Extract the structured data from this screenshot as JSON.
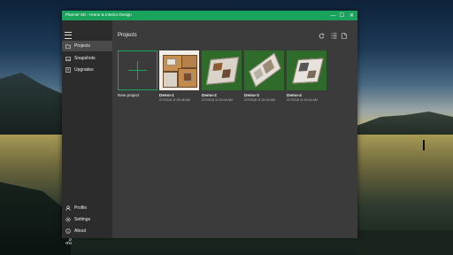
{
  "window": {
    "title": "Planner 5D - Home & Interior Design",
    "controls": {
      "minimize": "—",
      "maximize": "☐",
      "close": "✕"
    },
    "title_bar_color": "#1aa35d"
  },
  "sidebar": {
    "menu_icon": "hamburger-icon",
    "items": [
      {
        "label": "Projects",
        "icon": "folder-icon",
        "active": true
      },
      {
        "label": "Snapshots",
        "icon": "photo-icon"
      },
      {
        "label": "Upgrades",
        "icon": "upgrade-icon"
      }
    ],
    "bottom_items": [
      {
        "label": "Profile",
        "icon": "person-icon"
      },
      {
        "label": "Settings",
        "icon": "gear-icon"
      },
      {
        "label": "About",
        "icon": "info-icon"
      }
    ],
    "bottom_icon": "share-icon"
  },
  "main": {
    "title": "Projects",
    "toolbar": {
      "refresh_icon": "refresh-icon",
      "list_icon": "list-icon",
      "new_icon": "document-icon"
    },
    "new_project_label": "New project",
    "projects": [
      {
        "name": "Demo-1",
        "date": "2/7/2018 11:00:46 AM",
        "thumb": "top-down-plan"
      },
      {
        "name": "Demo-2",
        "date": "2/7/2018 11:00:44 AM",
        "thumb": "iso-green"
      },
      {
        "name": "Demo-3",
        "date": "2/7/2018 11:00:44 AM",
        "thumb": "iso-green"
      },
      {
        "name": "Demo-4",
        "date": "2/7/2018 11:00:44 AM",
        "thumb": "iso-green"
      }
    ]
  },
  "colors": {
    "accent": "#1aa35d",
    "sidebar": "#2c2c2c",
    "content": "#3b3b3b"
  }
}
